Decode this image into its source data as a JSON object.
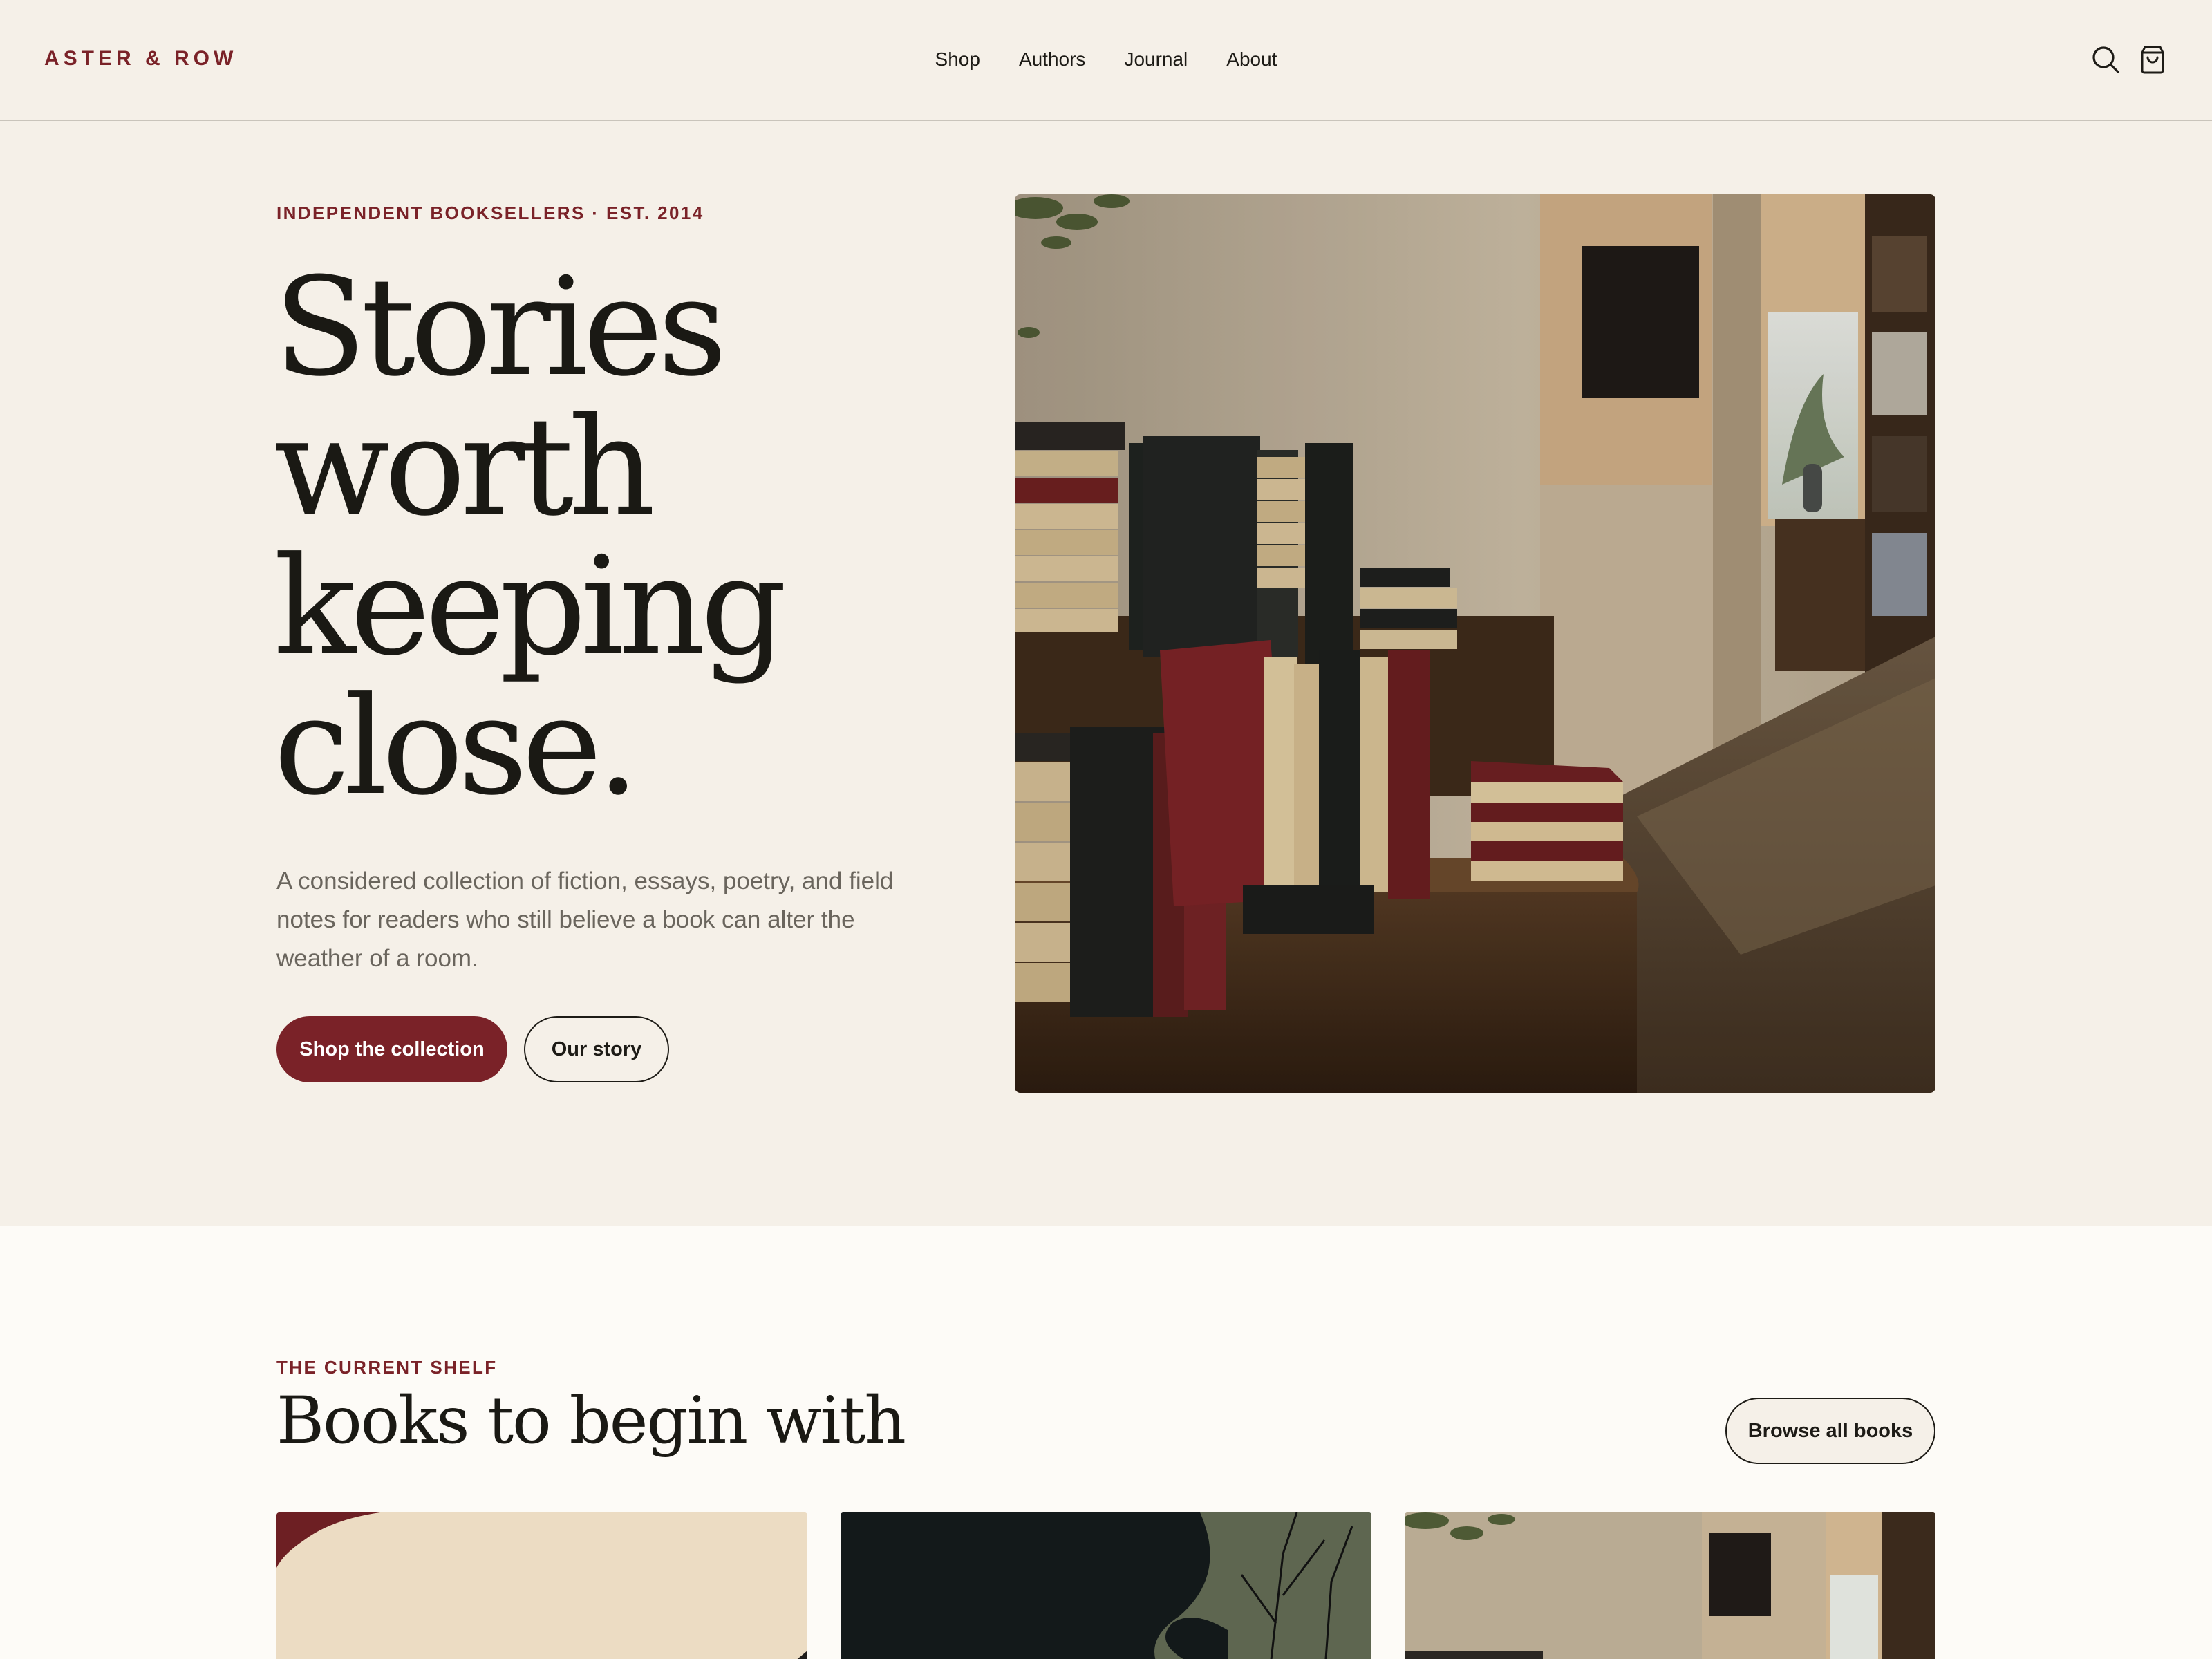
{
  "header": {
    "brand": "ASTER & ROW",
    "nav": [
      "Shop",
      "Authors",
      "Journal",
      "About"
    ],
    "icons": [
      "search-icon",
      "cart-icon"
    ]
  },
  "hero": {
    "eyebrow": "INDEPENDENT BOOKSELLERS · EST. 2014",
    "title_lines": [
      "Stories",
      "worth",
      "keeping",
      "close."
    ],
    "description": "A considered collection of fiction, essays, poetry, and field notes for readers who still believe a book can alter the weather of a room.",
    "primary_button": "Shop the collection",
    "secondary_button": "Our story"
  },
  "shelf": {
    "eyebrow": "THE CURRENT SHELF",
    "title": "Books to begin with",
    "browse_button": "Browse all books"
  },
  "colors": {
    "accent": "#7a2228",
    "background": "#f5f0e8",
    "section_background": "#fdfbf7",
    "text": "#1d1b16",
    "muted_text": "#6a655d"
  }
}
